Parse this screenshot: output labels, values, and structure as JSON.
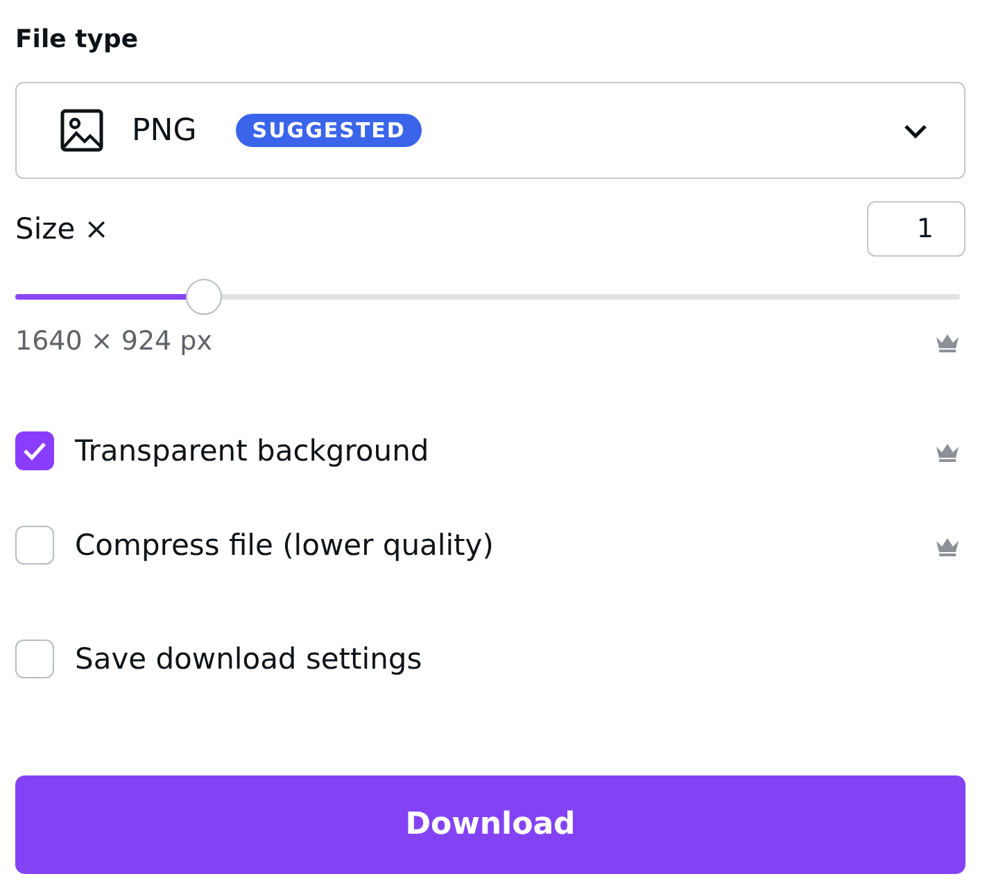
{
  "file_type": {
    "label": "File type",
    "value": "PNG",
    "badge": "SUGGESTED"
  },
  "size": {
    "label": "Size ×",
    "value": "1",
    "level": 0.2,
    "dimensions": "1640 × 924 px",
    "premium": true
  },
  "options": [
    {
      "label": "Transparent background",
      "checked": true,
      "premium": true
    },
    {
      "label": "Compress file (lower quality)",
      "checked": false,
      "premium": true
    },
    {
      "label": "Save download settings",
      "checked": false,
      "premium": false
    }
  ],
  "button": "Download"
}
